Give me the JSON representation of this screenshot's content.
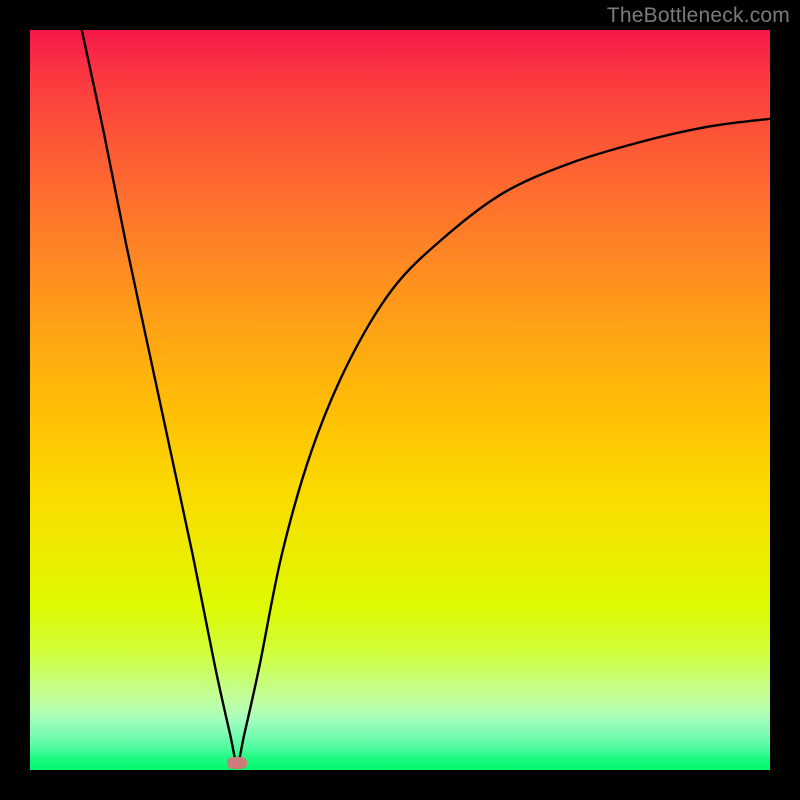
{
  "watermark": "TheBottleneck.com",
  "colors": {
    "frame": "#000000",
    "curve": "#000000",
    "marker": "#CC7C7A",
    "gradient_top": "#F71749",
    "gradient_bottom": "#00F96A"
  },
  "chart_data": {
    "type": "line",
    "title": "",
    "xlabel": "",
    "ylabel": "",
    "xlim": [
      0,
      100
    ],
    "ylim": [
      0,
      100
    ],
    "grid": false,
    "legend": false,
    "marker": {
      "x": 28,
      "y": 1
    },
    "series": [
      {
        "name": "curve",
        "x": [
          7,
          10,
          13,
          16,
          19,
          22,
          25,
          27,
          28,
          29,
          31,
          34,
          38,
          43,
          49,
          56,
          64,
          73,
          83,
          92,
          100
        ],
        "y": [
          100,
          86,
          71,
          57,
          43,
          29,
          14,
          5,
          1,
          5,
          14,
          29,
          43,
          55,
          65,
          72,
          78,
          82,
          85,
          87,
          88
        ]
      }
    ]
  }
}
